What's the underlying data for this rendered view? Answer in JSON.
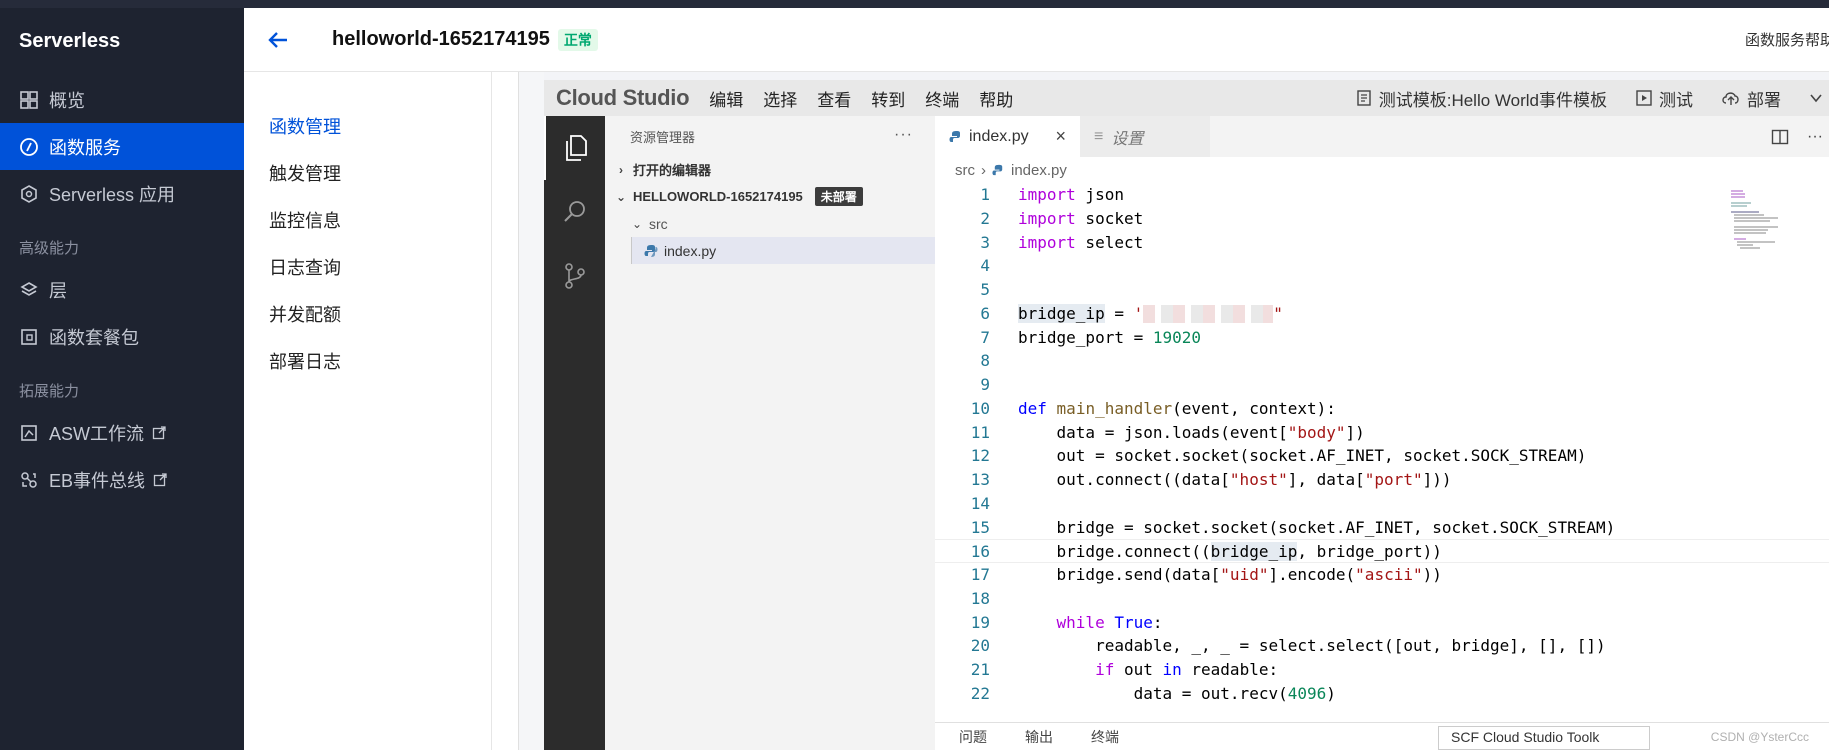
{
  "sidebar": {
    "brand": "Serverless",
    "items": [
      {
        "label": "概览",
        "icon": "grid-icon"
      },
      {
        "label": "函数服务",
        "icon": "function-icon",
        "active": true
      },
      {
        "label": "Serverless 应用",
        "icon": "app-icon"
      }
    ],
    "section_advanced": "高级能力",
    "advanced_items": [
      {
        "label": "层",
        "icon": "layers-icon"
      },
      {
        "label": "函数套餐包",
        "icon": "package-icon"
      }
    ],
    "section_extend": "拓展能力",
    "extend_items": [
      {
        "label": "ASW工作流",
        "icon": "workflow-icon"
      },
      {
        "label": "EB事件总线",
        "icon": "eventbus-icon"
      }
    ]
  },
  "header": {
    "function_name": "helloworld-1652174195",
    "status": "正常",
    "help": "函数服务帮助"
  },
  "submenu": [
    "函数管理",
    "触发管理",
    "监控信息",
    "日志查询",
    "并发配额",
    "部署日志"
  ],
  "ide": {
    "logo": "Cloud Studio",
    "menus": [
      "编辑",
      "选择",
      "查看",
      "转到",
      "终端",
      "帮助"
    ],
    "template": "测试模板:Hello World事件模板",
    "test": "测试",
    "deploy": "部署",
    "explorer": {
      "title": "资源管理器",
      "open_editors": "打开的编辑器",
      "project": "HELLOWORLD-1652174195",
      "undeployed": "未部署",
      "folder": "src",
      "file": "index.py"
    },
    "tabs": {
      "active": "index.py",
      "settings": "设置"
    },
    "breadcrumb": {
      "folder": "src",
      "file": "index.py"
    },
    "panel": {
      "problems": "问题",
      "output": "输出",
      "terminal": "终端",
      "select": "SCF Cloud Studio Toolk"
    },
    "watermark": "CSDN @YsterCcc"
  },
  "colors": {
    "accent": "#0052d9",
    "nav_bg": "#1e2330",
    "status_green": "#00a870"
  }
}
